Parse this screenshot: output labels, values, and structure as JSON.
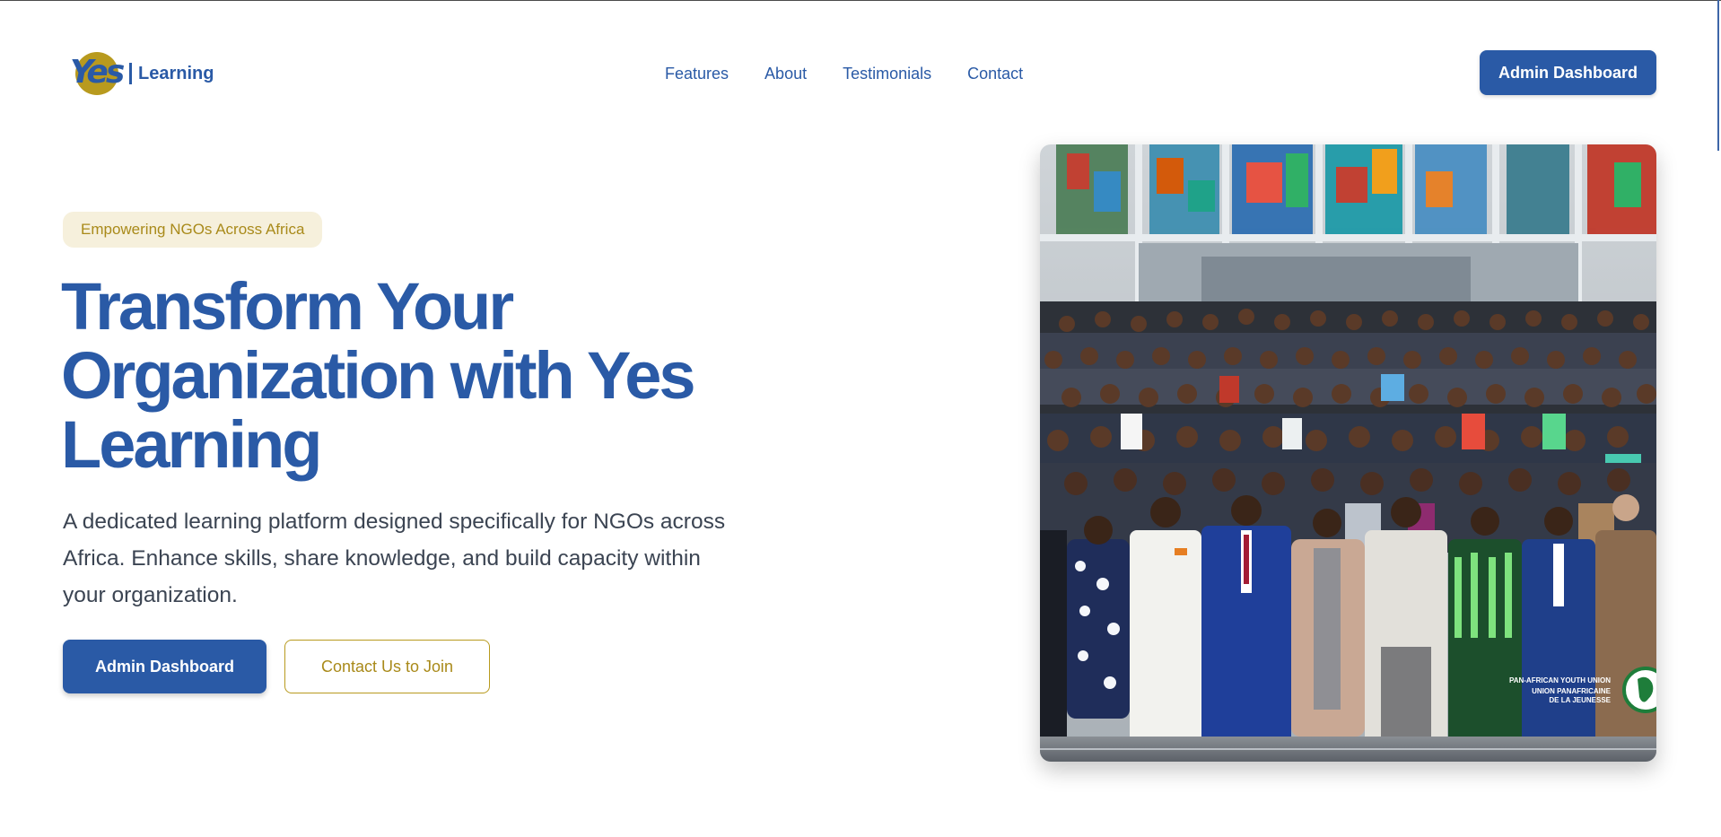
{
  "header": {
    "logo": {
      "mark_text": "Yes",
      "label": "Learning"
    },
    "nav": [
      {
        "label": "Features"
      },
      {
        "label": "About"
      },
      {
        "label": "Testimonials"
      },
      {
        "label": "Contact"
      }
    ],
    "cta_label": "Admin Dashboard"
  },
  "hero": {
    "badge": "Empowering NGOs Across Africa",
    "title_lines": [
      "Transform Your",
      "Organization with Yes",
      "Learning"
    ],
    "description": "A dedicated learning platform designed specifically for NGOs across Africa. Enhance skills, share knowledge, and build capacity within your organization.",
    "primary_button": "Admin Dashboard",
    "secondary_button": "Contact Us to Join",
    "photo": {
      "subject": "group photo of a large delegation standing on steps in front of a stained-glass building",
      "caption_lines": [
        "PAN-AFRICAN YOUTH UNION",
        "UNION PANAFRICAINE",
        "DE LA JEUNESSE"
      ]
    }
  },
  "colors": {
    "brand_blue": "#2a5aa6",
    "brand_gold": "#b89a1e",
    "badge_bg": "#f6f0dc",
    "body_text": "#3b4452"
  }
}
